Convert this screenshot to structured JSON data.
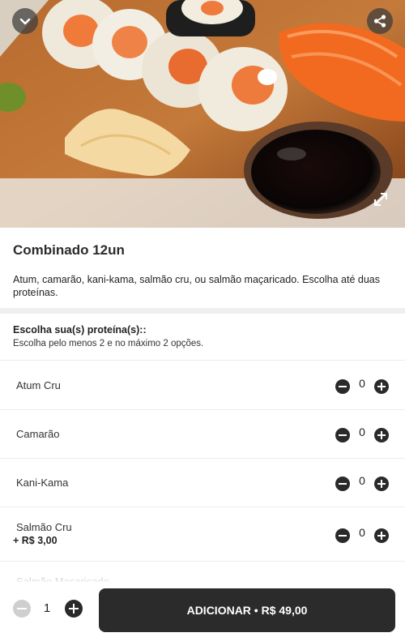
{
  "hero": {
    "image_alt": "sushi-platter-photo",
    "buttons": {
      "collapse_icon": "chevron-down-icon",
      "share_icon": "share-icon",
      "expand_icon": "expand-icon"
    }
  },
  "product": {
    "title": "Combinado 12un",
    "description": "Atum, camarão, kani-kama, salmão cru, ou salmão maçaricado. Escolha até duas proteínas."
  },
  "group": {
    "title": "Escolha sua(s) proteína(s)::",
    "subtitle": "Escolha pelo menos 2 e no máximo 2 opções."
  },
  "options": [
    {
      "name": "Atum Cru",
      "price": "",
      "quantity": "0"
    },
    {
      "name": "Camarão",
      "price": "",
      "quantity": "0"
    },
    {
      "name": "Kani-Kama",
      "price": "",
      "quantity": "0"
    },
    {
      "name": "Salmão Cru",
      "price": "+ R$ 3,00",
      "quantity": "0"
    }
  ],
  "next_option_partial": "Salmão Maçaricado",
  "cart": {
    "quantity": "1",
    "add_label": "ADICIONAR • R$ 49,00"
  },
  "colors": {
    "primary": "#2b2b2b",
    "disabled": "#cfcfcf",
    "separator": "#efefef"
  }
}
